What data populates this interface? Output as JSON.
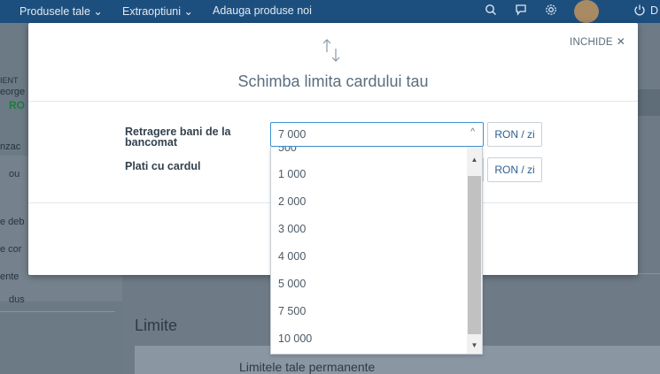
{
  "topnav": {
    "items": [
      "Produsele tale ⌄",
      "Extraoptiuni ⌄",
      "Adauga produse noi"
    ],
    "search_icon": "search-icon",
    "chat_icon": "chat-icon",
    "settings_icon": "gear-icon",
    "power_icon": "power-icon",
    "power_label": "D"
  },
  "background": {
    "left_labels": [
      "IENT",
      "eorge",
      "RO",
      "nzac",
      "ou",
      "e deb",
      "e cor",
      "ente",
      "dus"
    ],
    "limite_heading": "Limite",
    "card_title": "Limitele tale permanente"
  },
  "modal": {
    "close_label": "INCHIDE",
    "close_icon": "close-icon",
    "top_icon": "arrows-up-down-icon",
    "title": "Schimba limita cardului tau",
    "rows": [
      {
        "label": "Retragere bani de la bancomat",
        "value": "7 000",
        "unit": "RON / zi"
      },
      {
        "label": "Plati cu cardul",
        "value": "",
        "unit": "RON / zi"
      }
    ]
  },
  "dropdown": {
    "partial_option": "500",
    "options": [
      "1 000",
      "2 000",
      "3 000",
      "4 000",
      "5 000",
      "7 500",
      "10 000"
    ]
  },
  "colors": {
    "accent": "#3f91cf",
    "nav": "#1c4f7e",
    "overlay_bg": "#6f7c87",
    "green": "#1f7a3c"
  }
}
